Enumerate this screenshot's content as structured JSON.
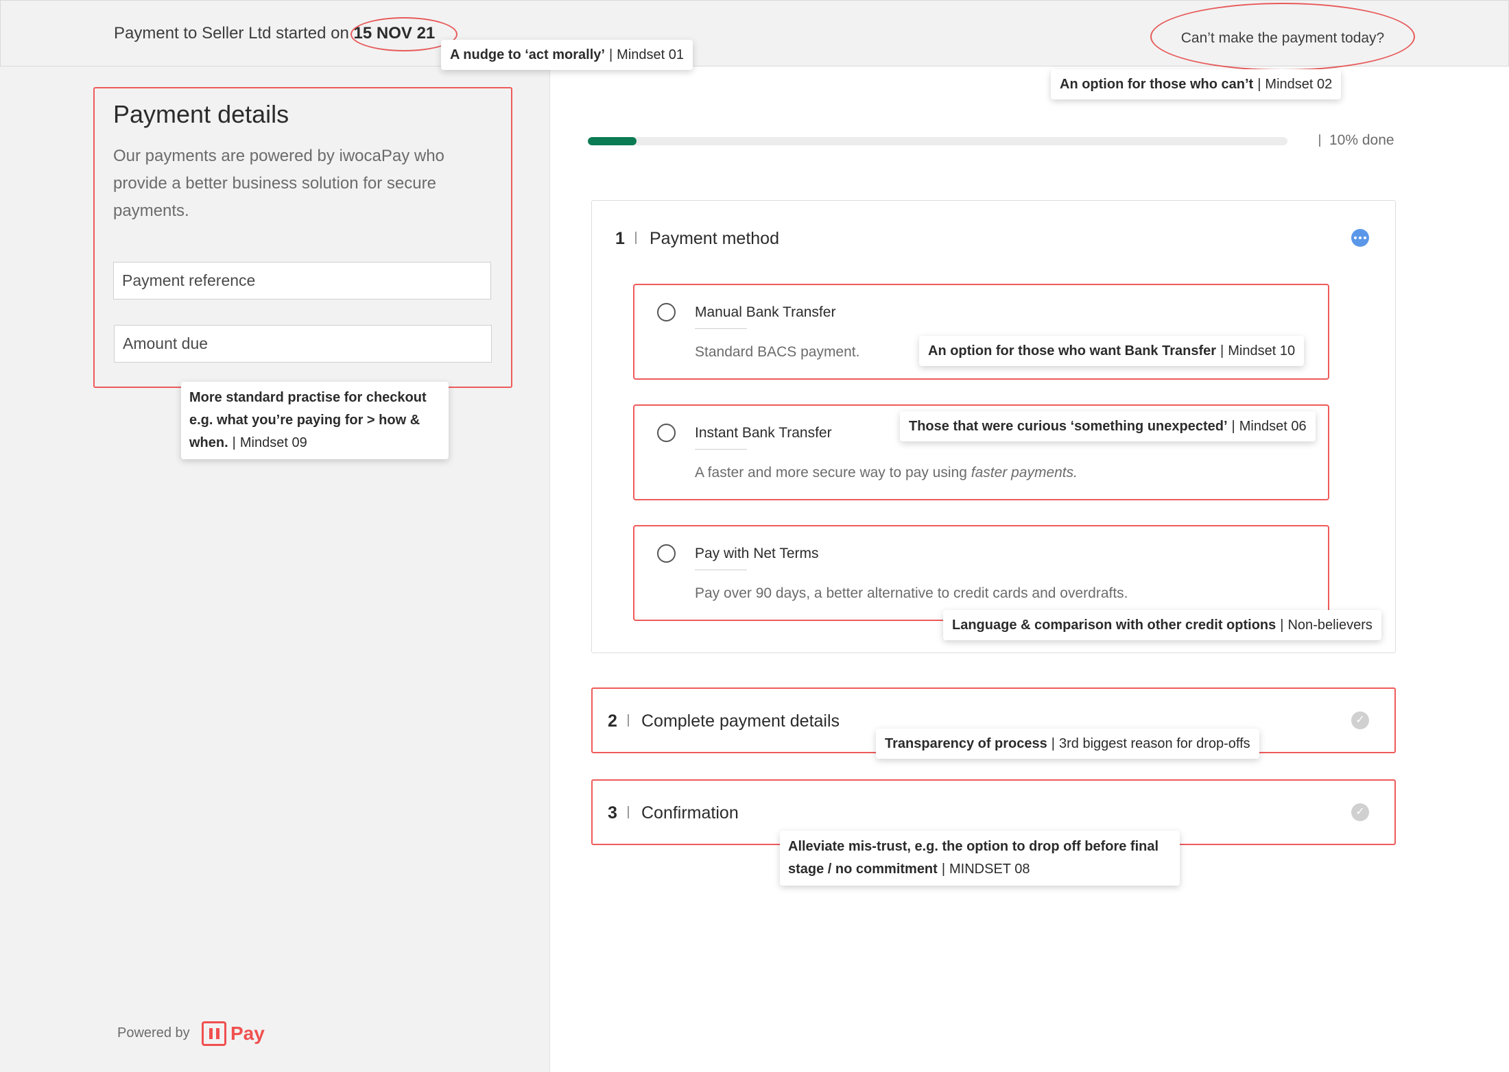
{
  "header": {
    "prefix": "Payment to Seller Ltd started on",
    "date": "15 NOV 21",
    "cant_pay_label": "Can’t make the payment today?"
  },
  "details": {
    "title": "Payment details",
    "description": "Our payments are powered by iwocaPay who provide a better business solution for secure payments.",
    "payment_reference": "Payment reference",
    "amount_due": "Amount due"
  },
  "footer": {
    "powered_by": "Powered by",
    "brand": "Pay"
  },
  "progress": {
    "percent": 10,
    "label": "10% done"
  },
  "steps": [
    {
      "number": "1",
      "title": "Payment method"
    },
    {
      "number": "2",
      "title": "Complete payment details"
    },
    {
      "number": "3",
      "title": "Confirmation"
    }
  ],
  "options": [
    {
      "title": "Manual Bank Transfer",
      "desc": "Standard BACS payment."
    },
    {
      "title": "Instant Bank Transfer",
      "desc": "A faster and more secure way to pay using",
      "desc_em": "faster payments."
    },
    {
      "title": "Pay with Net Terms",
      "desc": "Pay over 90 days, a better alternative to credit cards and overdrafts."
    }
  ],
  "notes": {
    "n1": {
      "bold": "A nudge to ‘act morally’",
      "tag": "Mindset 01"
    },
    "n2": {
      "bold": "An option for those who can’t",
      "tag": "Mindset 02"
    },
    "n3": {
      "bold": "An option for those who want  Bank Transfer",
      "tag": "Mindset 10"
    },
    "n4": {
      "bold": "Those that were curious ‘something unexpected’",
      "tag": "Mindset 06"
    },
    "n5": {
      "bold": "Language & comparison with other credit options",
      "tag": "Non-believers"
    },
    "n6": {
      "bold": "Transparency of process",
      "tag": "3rd biggest reason for drop-offs"
    },
    "n7": {
      "bold": "Alleviate mis-trust, e.g. the option to drop off before final stage / no commitment",
      "tag": "MINDSET 08"
    },
    "n8": {
      "bold": "More standard practise for checkout e.g. what you’re paying for > how & when.",
      "tag": "Mindset 09"
    }
  },
  "colors": {
    "accent_red": "#ef5a5a",
    "progress_green": "#0b7b53",
    "info_blue": "#5b97e8"
  }
}
